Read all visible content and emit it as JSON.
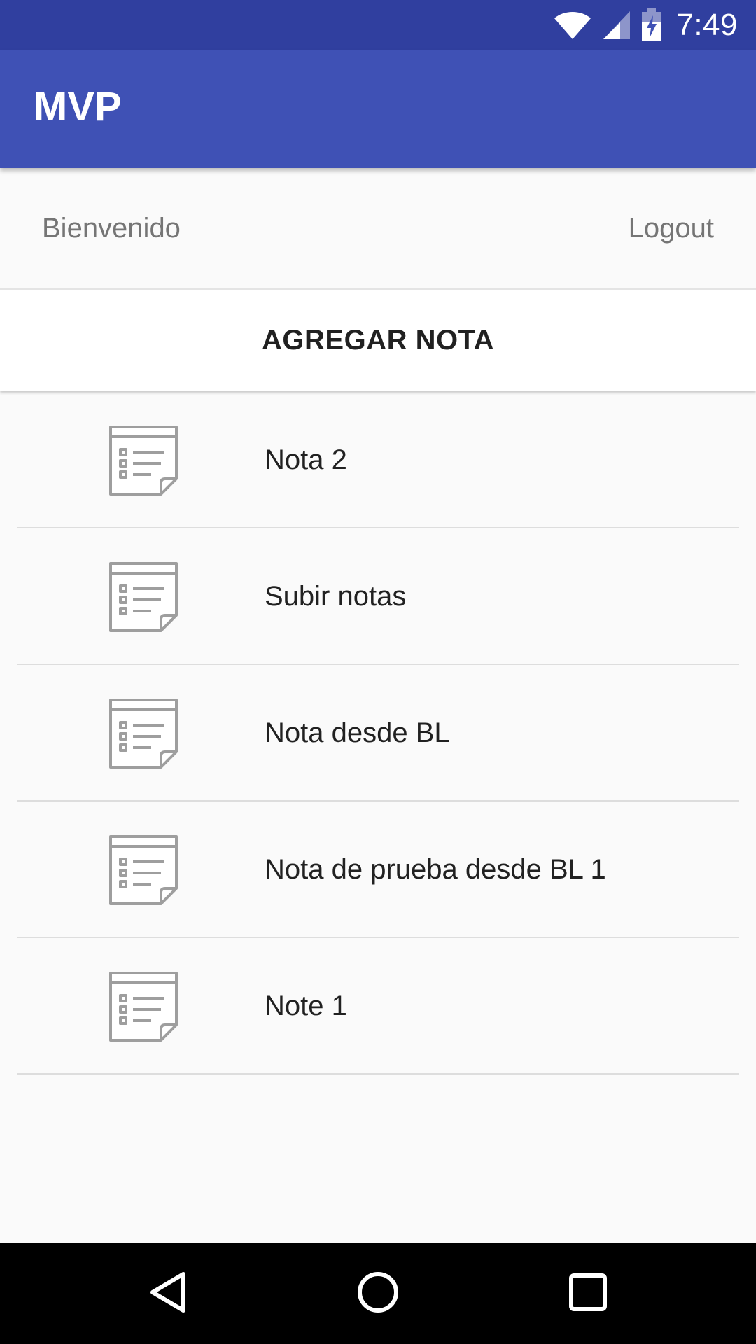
{
  "status_bar": {
    "time": "7:49",
    "icons": [
      "wifi-icon",
      "signal-icon",
      "battery-charging-icon"
    ]
  },
  "app_bar": {
    "title": "MVP",
    "background_color": "#3f51b5",
    "status_color": "#303f9f"
  },
  "welcome": {
    "greeting": "Bienvenido",
    "logout_label": "Logout"
  },
  "add_note": {
    "label": "AGREGAR NOTA"
  },
  "notes": [
    {
      "title": "Nota 2",
      "icon": "note-icon"
    },
    {
      "title": "Subir notas",
      "icon": "note-icon"
    },
    {
      "title": "Nota desde BL",
      "icon": "note-icon"
    },
    {
      "title": "Nota de prueba desde BL 1",
      "icon": "note-icon"
    },
    {
      "title": "Note 1",
      "icon": "note-icon"
    }
  ],
  "nav_bar": {
    "buttons": [
      "back-icon",
      "home-icon",
      "recents-icon"
    ]
  }
}
